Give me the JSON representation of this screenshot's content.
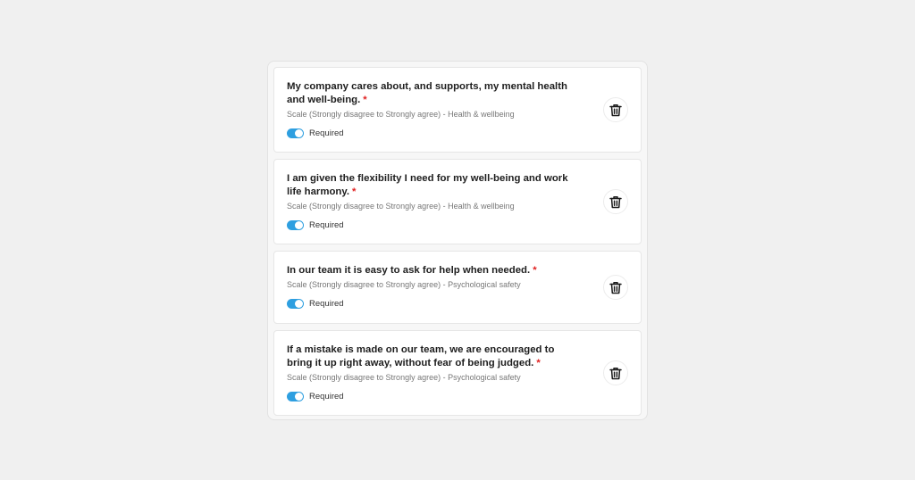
{
  "questions": [
    {
      "title": "My company cares about, and supports, my mental health and well-being.",
      "star": "*",
      "meta": "Scale (Strongly disagree to Strongly agree) - Health & wellbeing",
      "required_label": "Required",
      "required_on": true
    },
    {
      "title": "I am given the flexibility I need for my well-being and work life harmony.",
      "star": "*",
      "meta": "Scale (Strongly disagree to Strongly agree) - Health & wellbeing",
      "required_label": "Required",
      "required_on": true
    },
    {
      "title": "In our team it is easy to ask for help when needed.",
      "star": "*",
      "meta": "Scale (Strongly disagree to Strongly agree) - Psychological safety",
      "required_label": "Required",
      "required_on": true
    },
    {
      "title": "If a mistake is made on our team, we are encouraged to bring it up right away, without fear of being judged.",
      "star": "*",
      "meta": "Scale (Strongly disagree to Strongly agree) - Psychological safety",
      "required_label": "Required",
      "required_on": true
    }
  ],
  "icons": {
    "delete": "trash-icon",
    "toggle": "toggle-switch"
  },
  "colors": {
    "toggle_on": "#2e9fe0",
    "required_star": "#e02020",
    "title_text": "#1e1e1e",
    "meta_text": "#777777"
  }
}
